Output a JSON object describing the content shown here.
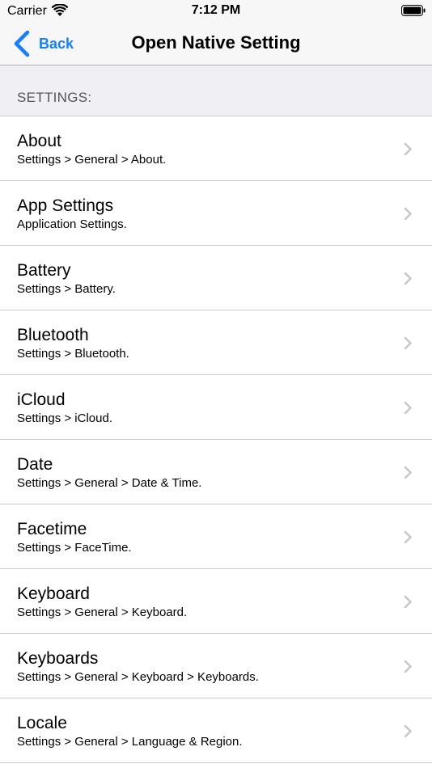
{
  "status_bar": {
    "carrier": "Carrier",
    "time": "7:12 PM"
  },
  "nav": {
    "back_label": "Back",
    "title": "Open Native Setting"
  },
  "section": {
    "header": "SETTINGS:"
  },
  "items": [
    {
      "title": "About",
      "subtitle": "Settings > General > About."
    },
    {
      "title": "App Settings",
      "subtitle": "Application Settings."
    },
    {
      "title": "Battery",
      "subtitle": "Settings > Battery."
    },
    {
      "title": "Bluetooth",
      "subtitle": "Settings > Bluetooth."
    },
    {
      "title": "iCloud",
      "subtitle": "Settings > iCloud."
    },
    {
      "title": "Date",
      "subtitle": "Settings > General > Date & Time."
    },
    {
      "title": "Facetime",
      "subtitle": "Settings > FaceTime."
    },
    {
      "title": "Keyboard",
      "subtitle": "Settings > General > Keyboard."
    },
    {
      "title": "Keyboards",
      "subtitle": "Settings > General > Keyboard > Keyboards."
    },
    {
      "title": "Locale",
      "subtitle": "Settings > General > Language & Region."
    }
  ],
  "colors": {
    "accent": "#157efb",
    "nav_background": "#f7f7f7",
    "section_background": "#efeff4",
    "separator": "#c8c7cc",
    "chevron": "#c7c7cc"
  }
}
